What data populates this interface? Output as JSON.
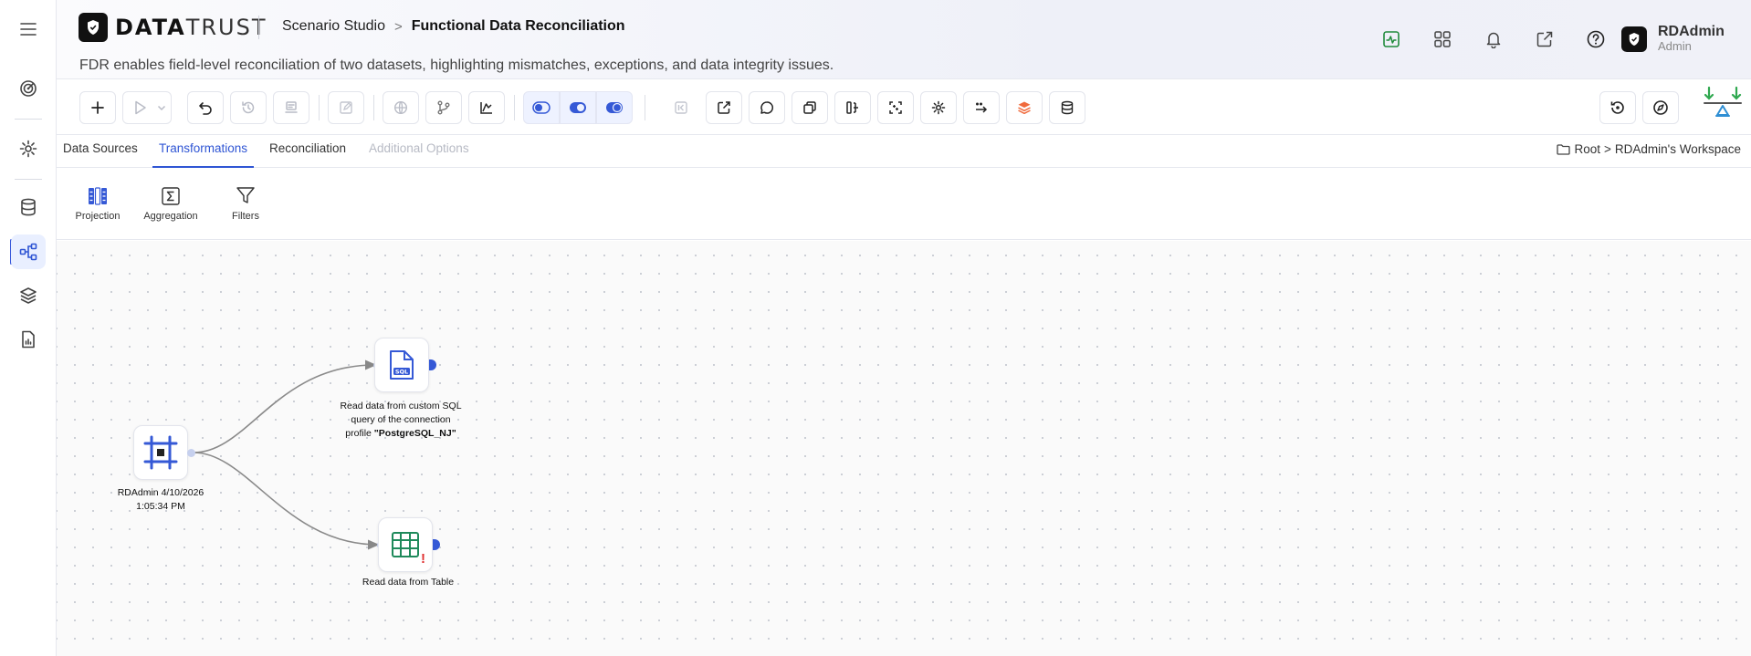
{
  "app": {
    "logo_bold": "DATA",
    "logo_rest": "TRUST"
  },
  "header": {
    "breadcrumb_parent": "Scenario Studio",
    "breadcrumb_separator": ">",
    "title": "Functional Data Reconciliation",
    "subtitle": "FDR enables field-level reconciliation of two datasets, highlighting mismatches, exceptions, and data integrity issues.",
    "icons": [
      "activity-icon",
      "grid-icon",
      "bell-icon",
      "external-link-icon",
      "help-icon"
    ]
  },
  "user": {
    "name": "RDAdmin",
    "role": "Admin"
  },
  "sidebar": {
    "items": [
      "menu-icon",
      "target-icon",
      "settings-icon",
      "database-icon",
      "workflow-icon",
      "layers-icon",
      "report-icon"
    ],
    "active": "workflow-icon"
  },
  "toolbar": {
    "items": [
      "add",
      "run",
      "run-dropdown",
      "undo",
      "history",
      "clear",
      "edit",
      "globe",
      "branch",
      "chart",
      "toggle-left",
      "toggle-both",
      "toggle-right",
      "skip",
      "export",
      "comment",
      "copy",
      "split",
      "capture",
      "settings",
      "transfer",
      "layers",
      "database",
      "restore",
      "compass",
      "reconcile"
    ]
  },
  "tabs": [
    {
      "label": "Data Sources",
      "state": "normal"
    },
    {
      "label": "Transformations",
      "state": "active"
    },
    {
      "label": "Reconciliation",
      "state": "normal"
    },
    {
      "label": "Additional Options",
      "state": "disabled"
    }
  ],
  "workspace": {
    "root": "Root",
    "separator": ">",
    "name": "RDAdmin's Workspace"
  },
  "palette": [
    {
      "label": "Projection"
    },
    {
      "label": "Aggregation"
    },
    {
      "label": "Filters"
    }
  ],
  "canvas": {
    "start_node": {
      "label": "RDAdmin 4/10/2026 1:05:34 PM"
    },
    "sql_node": {
      "label_prefix": "Read data from custom SQL query of the connection profile ",
      "profile": "\"PostgreSQL_NJ\""
    },
    "table_node": {
      "label": "Read data from Table",
      "warning": "!"
    }
  },
  "colors": {
    "accent": "#2f55d4",
    "port": "#3559d6",
    "table": "#1f8a5b",
    "warning": "#e03131",
    "layers": "#f06a3c"
  }
}
